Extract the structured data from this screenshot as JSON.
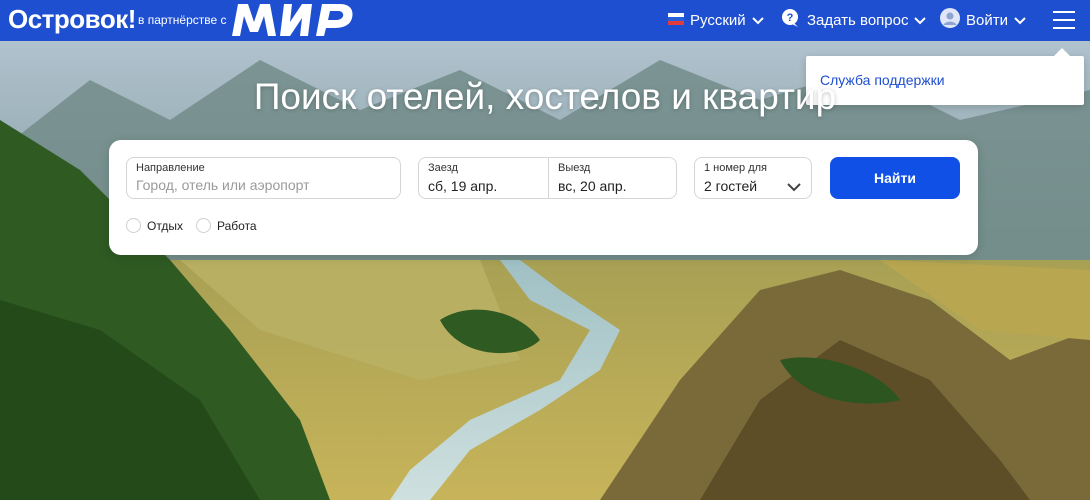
{
  "header": {
    "logo": "Островок!",
    "partner_text": "в партнёрстве с",
    "partner_logo": "МИР",
    "language": {
      "label": "Русский",
      "flag": "russia-flag-icon"
    },
    "ask": {
      "label": "Задать вопрос",
      "icon": "question-bubble-icon"
    },
    "login": {
      "label": "Войти",
      "icon": "user-avatar-icon"
    },
    "menu_icon": "hamburger-menu-icon"
  },
  "dropdown": {
    "items": [
      {
        "label": "Служба поддержки"
      }
    ]
  },
  "hero": {
    "title": "Поиск отелей, хостелов и квартир"
  },
  "search": {
    "destination": {
      "label": "Направление",
      "placeholder": "Город, отель или аэропорт",
      "value": ""
    },
    "checkin": {
      "label": "Заезд",
      "value": "сб, 19 апр."
    },
    "checkout": {
      "label": "Выезд",
      "value": "вс, 20 апр."
    },
    "guests": {
      "label": "1 номер для",
      "value": "2 гостей"
    },
    "submit_label": "Найти",
    "trip_types": [
      {
        "label": "Отдых"
      },
      {
        "label": "Работа"
      }
    ]
  },
  "colors": {
    "brand": "#1e4fd0",
    "button": "#1150e6",
    "link": "#1e4fd0"
  }
}
